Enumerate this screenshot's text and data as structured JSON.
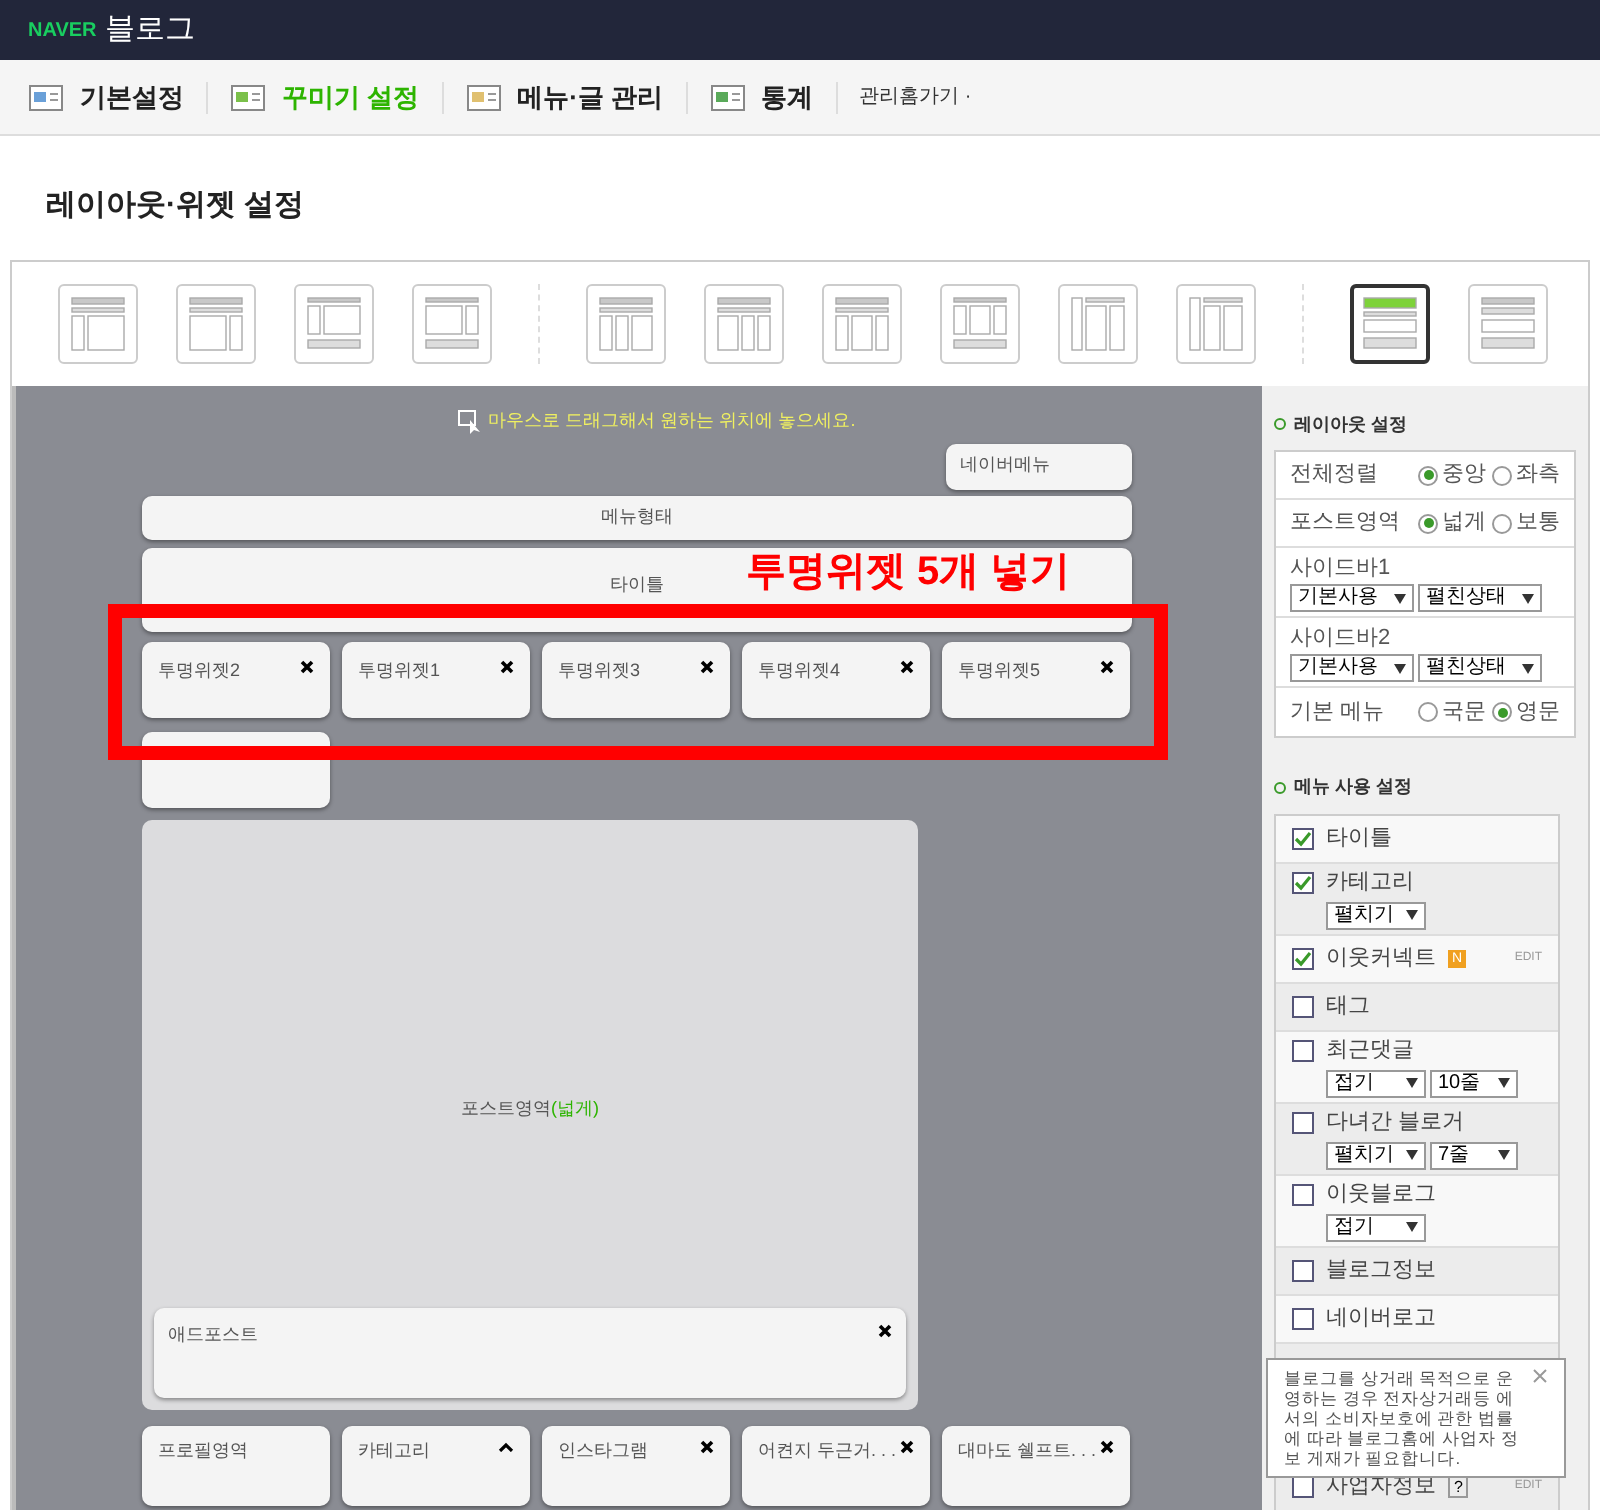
{
  "brand": {
    "logo": "NAVER",
    "title": "블로그"
  },
  "nav": [
    {
      "label": "기본설정",
      "selected": false
    },
    {
      "label": "꾸미기 설정",
      "selected": true
    },
    {
      "label": "메뉴·글 관리",
      "selected": false
    },
    {
      "label": "통계",
      "selected": false
    }
  ],
  "nav_link": "관리홈가기 ·",
  "page_title": "레이아웃·위젯 설정",
  "layouts": [
    {
      "selected": false
    },
    {
      "selected": false
    },
    {
      "selected": false
    },
    {
      "selected": false
    },
    {
      "selected": false
    },
    {
      "selected": false
    },
    {
      "selected": false
    },
    {
      "selected": false
    },
    {
      "selected": false
    },
    {
      "selected": false
    },
    {
      "selected": true
    },
    {
      "selected": false
    }
  ],
  "canvas": {
    "hint": "마우스로 드래그해서 원하는 위치에 놓으세요.",
    "naver_menu": "네이버메뉴",
    "menu_type": "메뉴형태",
    "title_block": "타이틀",
    "widgets": [
      {
        "label": "투명위젯2"
      },
      {
        "label": "투명위젯1"
      },
      {
        "label": "투명위젯3"
      },
      {
        "label": "투명위젯4"
      },
      {
        "label": "투명위젯5"
      }
    ],
    "post_area": {
      "label": "포스트영역",
      "note": "(넓게)"
    },
    "adpost": "애드포스트",
    "bottom_widgets": [
      {
        "label": "프로필영역",
        "kind": "plain"
      },
      {
        "label": "카테고리",
        "kind": "collapse"
      },
      {
        "label": "인스타그램",
        "kind": "close"
      },
      {
        "label": "어켠지 두근거. . .",
        "kind": "close"
      },
      {
        "label": "대마도 쉘프트. . .",
        "kind": "close"
      }
    ]
  },
  "annotation": "투명위젯 5개 넣기",
  "layout_settings": {
    "heading": "레이아웃 설정",
    "rows": [
      {
        "kind": "radio",
        "label": "전체정렬",
        "options": [
          {
            "label": "중앙",
            "selected": true
          },
          {
            "label": "좌측",
            "selected": false
          }
        ]
      },
      {
        "kind": "radio",
        "label": "포스트영역",
        "options": [
          {
            "label": "넓게",
            "selected": true
          },
          {
            "label": "보통",
            "selected": false
          }
        ]
      },
      {
        "kind": "select",
        "label": "사이드바1",
        "selects": [
          "기본사용",
          "펼친상태"
        ]
      },
      {
        "kind": "select",
        "label": "사이드바2",
        "selects": [
          "기본사용",
          "펼친상태"
        ]
      },
      {
        "kind": "radio",
        "label": "기본 메뉴",
        "options": [
          {
            "label": "국문",
            "selected": false
          },
          {
            "label": "영문",
            "selected": true
          }
        ]
      }
    ]
  },
  "menu_settings": {
    "heading": "메뉴 사용 설정",
    "items": [
      {
        "label": "타이틀",
        "checked": true
      },
      {
        "label": "카테고리",
        "checked": true,
        "selects": [
          "펼치기"
        ]
      },
      {
        "label": "이웃커넥트",
        "checked": true,
        "badge": "N",
        "edit": "EDIT"
      },
      {
        "label": "태그",
        "checked": false
      },
      {
        "label": "최근댓글",
        "checked": false,
        "selects": [
          "접기",
          "10줄"
        ]
      },
      {
        "label": "다녀간 블로거",
        "checked": false,
        "selects": [
          "펼치기",
          "7줄"
        ]
      },
      {
        "label": "이웃블로그",
        "checked": false,
        "selects": [
          "접기"
        ]
      },
      {
        "label": "블로그정보",
        "checked": false
      },
      {
        "label": "네이버로고",
        "checked": false
      },
      {
        "label": "사업자정보",
        "checked": false,
        "help": "?",
        "edit": "EDIT"
      }
    ]
  },
  "tooltip": "블로그를 상거래 목적으로 운영하는 경우 전자상거래등 에서의 소비자보호에 관한 법률에 따라 블로그홈에 사업자 정보 게재가 필요합니다."
}
